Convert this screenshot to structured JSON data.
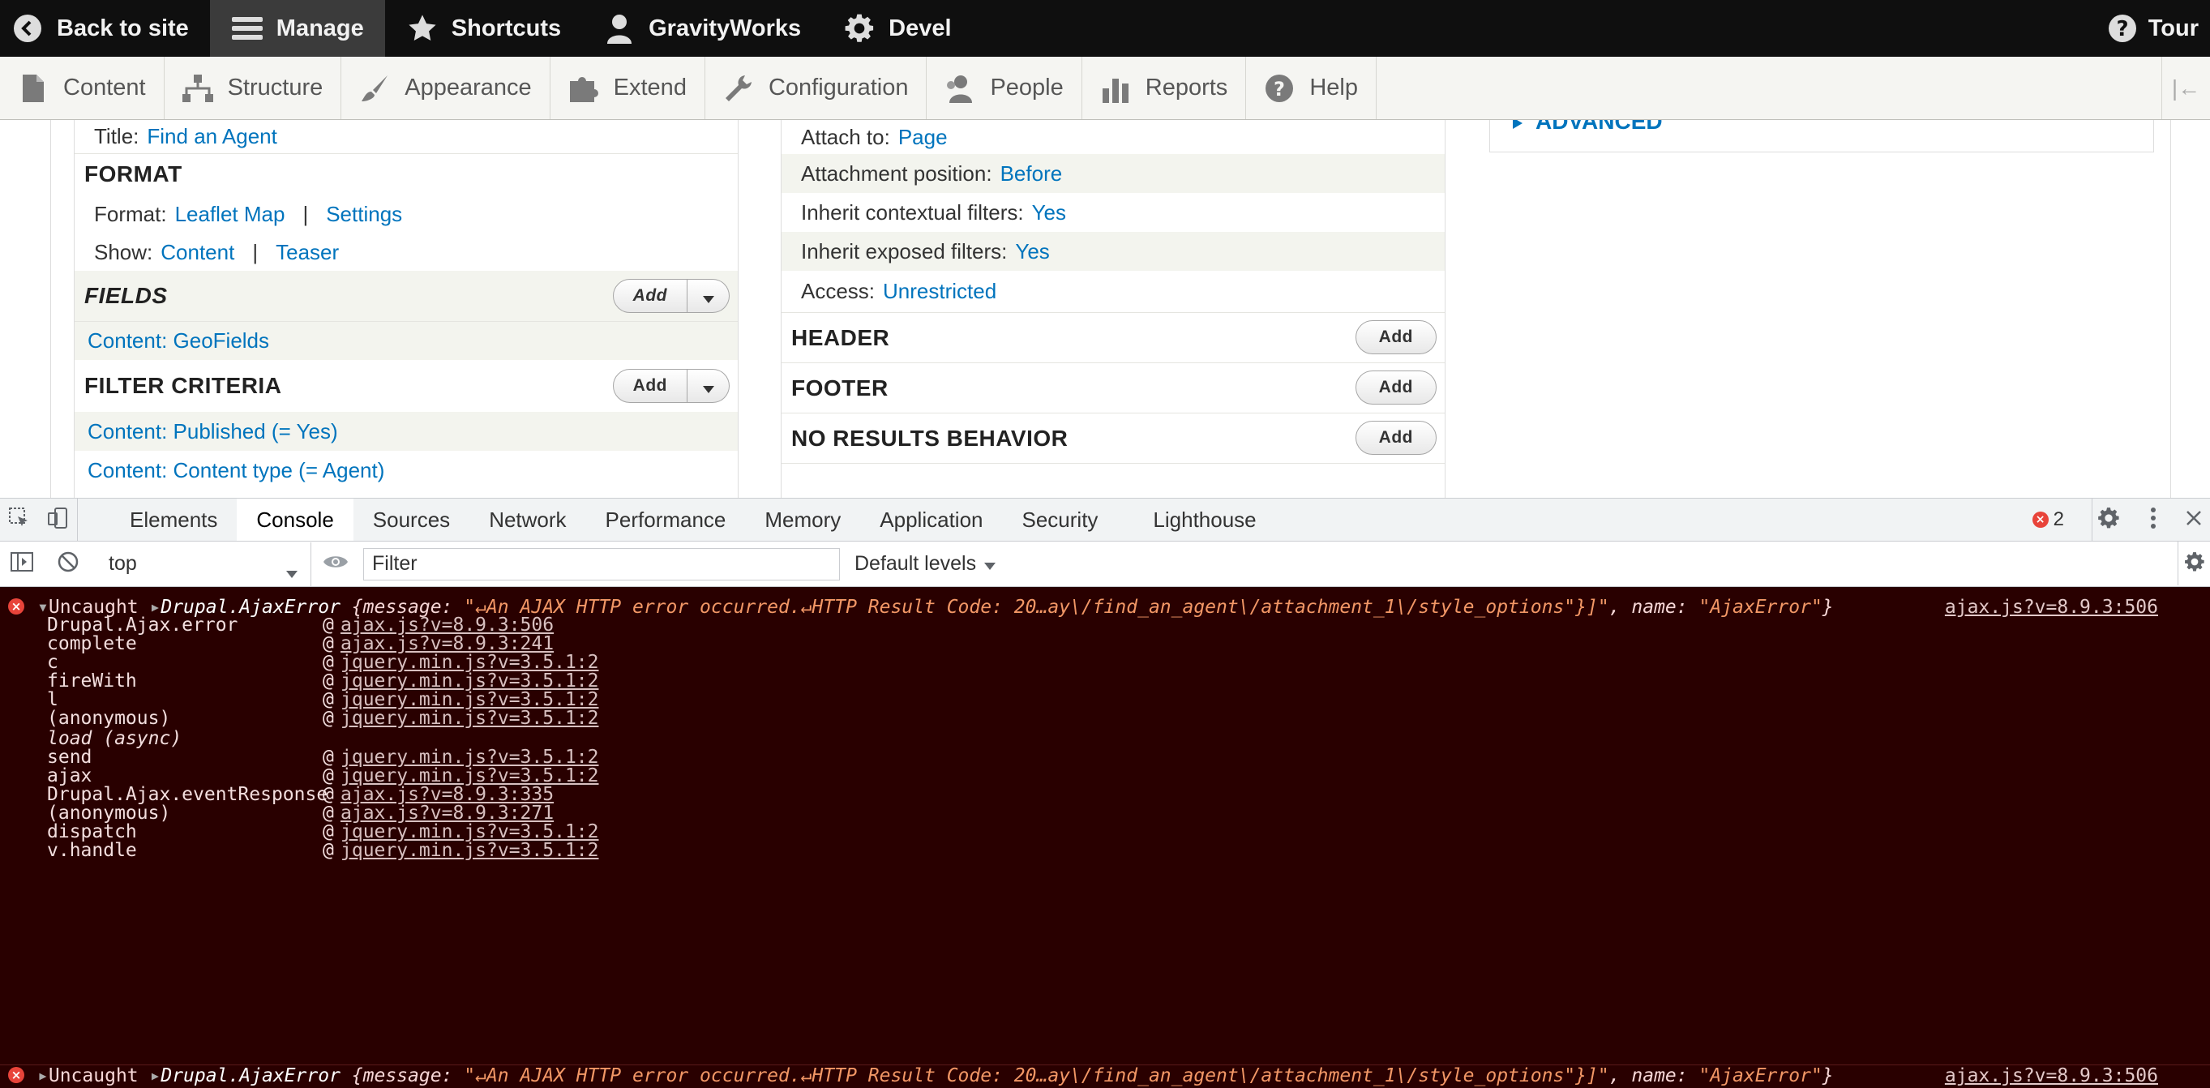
{
  "toolbar": {
    "back": "Back to site",
    "manage": "Manage",
    "shortcuts": "Shortcuts",
    "user": "GravityWorks",
    "devel": "Devel",
    "tour": "Tour"
  },
  "tray": {
    "items": [
      "Content",
      "Structure",
      "Appearance",
      "Extend",
      "Configuration",
      "People",
      "Reports",
      "Help"
    ]
  },
  "col1": {
    "title_label": "Title:",
    "title_value": "Find an Agent",
    "format_heading": "FORMAT",
    "format_label": "Format:",
    "format_value": "Leaflet Map",
    "format_sep": "|",
    "format_settings": "Settings",
    "show_label": "Show:",
    "show_value": "Content",
    "show_sep": "|",
    "show_teaser": "Teaser",
    "fields_heading": "FIELDS",
    "fields_add": "Add",
    "field_item": "Content: GeoFields",
    "filter_heading": "FILTER CRITERIA",
    "filter_add": "Add",
    "filter_item1": "Content: Published (= Yes)",
    "filter_item2": "Content: Content type (= Agent)"
  },
  "col2": {
    "attach_label": "Attach to:",
    "attach_value": "Page",
    "position_label": "Attachment position:",
    "position_value": "Before",
    "inherit_ctx_label": "Inherit contextual filters:",
    "inherit_ctx_value": "Yes",
    "inherit_exp_label": "Inherit exposed filters:",
    "inherit_exp_value": "Yes",
    "access_label": "Access:",
    "access_value": "Unrestricted",
    "header_heading": "HEADER",
    "footer_heading": "FOOTER",
    "noresults_heading": "NO RESULTS BEHAVIOR",
    "add": "Add"
  },
  "col3": {
    "advanced": "ADVANCED"
  },
  "devtools": {
    "tabs": [
      "Elements",
      "Console",
      "Sources",
      "Network",
      "Performance",
      "Memory",
      "Application",
      "Security",
      "Lighthouse"
    ],
    "error_count": "2",
    "context": "top",
    "filter_placeholder": "Filter",
    "levels": "Default levels"
  },
  "console": {
    "uncaught": "Uncaught",
    "error_type": "Drupal.AjaxError",
    "message_key": "{message: ",
    "message_value": "\"↵An AJAX HTTP error occurred.↵HTTP Result Code: 20…ay\\/find_an_agent\\/attachment_1\\/style_options\"}]\"",
    "name_key": ", name: ",
    "name_value": "\"AjaxError\"",
    "close_brace": "}",
    "source": "ajax.js?v=8.9.3:506",
    "frames": [
      {
        "name": "Drupal.Ajax.error",
        "src": "ajax.js?v=8.9.3:506"
      },
      {
        "name": "complete",
        "src": "ajax.js?v=8.9.3:241"
      },
      {
        "name": "c",
        "src": "jquery.min.js?v=3.5.1:2"
      },
      {
        "name": "fireWith",
        "src": "jquery.min.js?v=3.5.1:2"
      },
      {
        "name": "l",
        "src": "jquery.min.js?v=3.5.1:2"
      },
      {
        "name": "(anonymous)",
        "src": "jquery.min.js?v=3.5.1:2"
      },
      {
        "name": "load (async)",
        "src": ""
      },
      {
        "name": "send",
        "src": "jquery.min.js?v=3.5.1:2"
      },
      {
        "name": "ajax",
        "src": "jquery.min.js?v=3.5.1:2"
      },
      {
        "name": "Drupal.Ajax.eventResponse",
        "src": "ajax.js?v=8.9.3:335"
      },
      {
        "name": "(anonymous)",
        "src": "ajax.js?v=8.9.3:271"
      },
      {
        "name": "dispatch",
        "src": "jquery.min.js?v=3.5.1:2"
      },
      {
        "name": "v.handle",
        "src": "jquery.min.js?v=3.5.1:2"
      }
    ],
    "at": "@"
  }
}
